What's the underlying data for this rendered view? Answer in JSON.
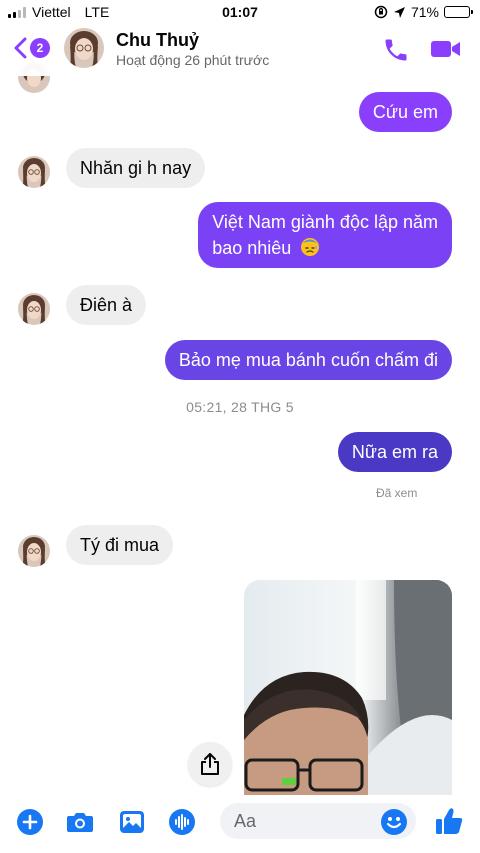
{
  "status_bar": {
    "carrier": "Viettel",
    "network": "LTE",
    "time": "01:07",
    "battery": "71%",
    "battery_level": 0.71
  },
  "header": {
    "back_badge": "2",
    "contact_name": "Chu Thuỷ",
    "contact_status": "Hoạt động 26 phút trước",
    "icons": [
      "back-chevron-icon",
      "phone-icon",
      "video-camera-icon"
    ]
  },
  "messages": [
    {
      "dir": "out",
      "text": "Cứu em"
    },
    {
      "dir": "in",
      "text": "Nhăn gi h nay"
    },
    {
      "dir": "out",
      "line1": "Việt Nam giành độc lập năm",
      "line2": "bao nhiêu"
    },
    {
      "dir": "in",
      "text": "Điên à"
    },
    {
      "dir": "out",
      "text": "Bảo mẹ mua bánh cuốn chấm đi"
    },
    {
      "dir": "out",
      "text": "Nữa em ra"
    },
    {
      "dir": "in",
      "text": "Tý đi mua"
    }
  ],
  "timestamp": "05:21, 28 THG 5",
  "seen_label": "Đã xem",
  "composer": {
    "placeholder": "Aa",
    "icons": [
      "plus-icon",
      "camera-icon",
      "gallery-icon",
      "voice-icon",
      "emoji-icon",
      "thumbs-up-icon"
    ]
  },
  "colors": {
    "accent": "#8a3ffc",
    "bubble_purple": "#8a3ffc",
    "bubble_violet": "#6a45e6",
    "bubble_indigo": "#4939c4",
    "incoming": "#eeeeee"
  }
}
